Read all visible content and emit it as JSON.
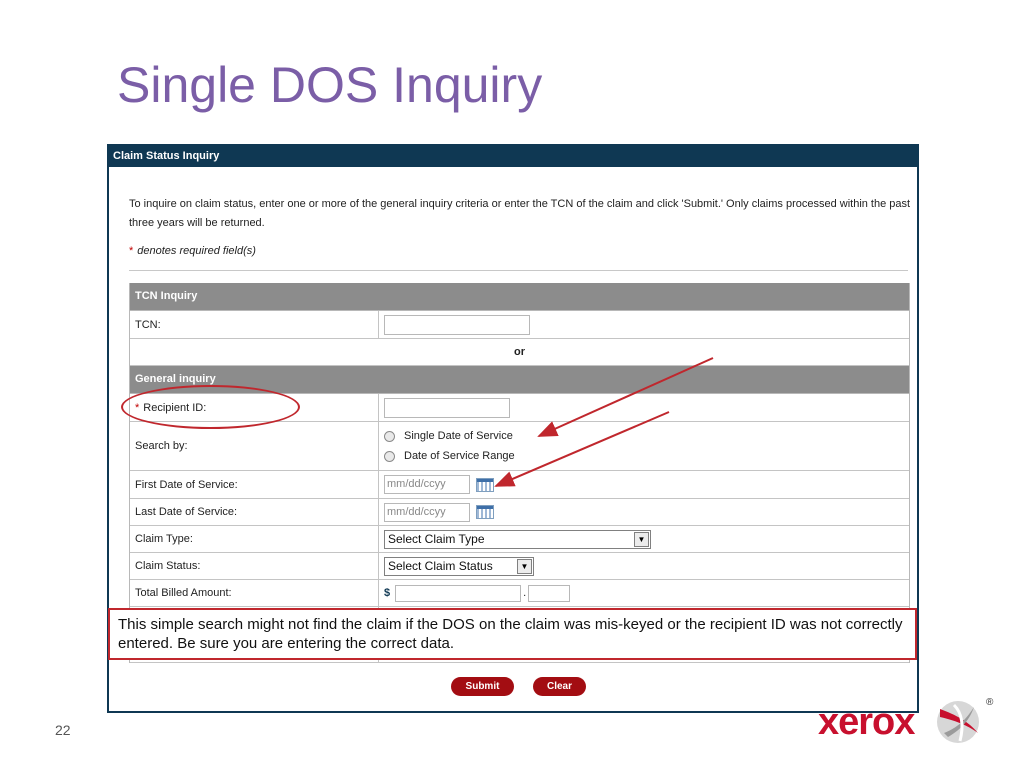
{
  "slide": {
    "title": "Single DOS Inquiry",
    "page_number": "22",
    "logo_text": "xerox",
    "logo_reg": "®"
  },
  "form": {
    "header": "Claim Status Inquiry",
    "intro": "To inquire on claim status, enter one or more of the general inquiry criteria or enter the TCN of the claim and click 'Submit.' Only claims processed within the past three years will be returned.",
    "required_star": "*",
    "required_note": "denotes required field(s)",
    "tcn_section": "TCN Inquiry",
    "tcn_label": "TCN:",
    "or_text": "or",
    "general_section": "General inquiry",
    "recipient_label": "Recipient ID:",
    "search_by_label": "Search by:",
    "search_options": [
      "Single Date of Service",
      "Date of Service Range"
    ],
    "first_dos_label": "First Date of Service:",
    "last_dos_label": "Last Date of Service:",
    "date_placeholder": "mm/dd/ccyy",
    "claim_type_label": "Claim Type:",
    "claim_type_value": "Select Claim Type",
    "claim_status_label": "Claim Status:",
    "claim_status_value": "Select Claim Status",
    "billed_label": "Total Billed Amount:",
    "currency_symbol": "$",
    "decimal_point": ".",
    "submit_label": "Submit",
    "clear_label": "Clear"
  },
  "callout": {
    "text": "This simple search might not find the claim if the DOS on the claim was mis-keyed or the recipient ID was not correctly entered. Be sure you are entering the correct data."
  },
  "colors": {
    "title": "#7b5ea7",
    "header_bar": "#0f3853",
    "section_bar": "#8c8c8c",
    "annotation_red": "#c0272d",
    "button_red": "#a30d12",
    "logo_red": "#c8102e"
  }
}
